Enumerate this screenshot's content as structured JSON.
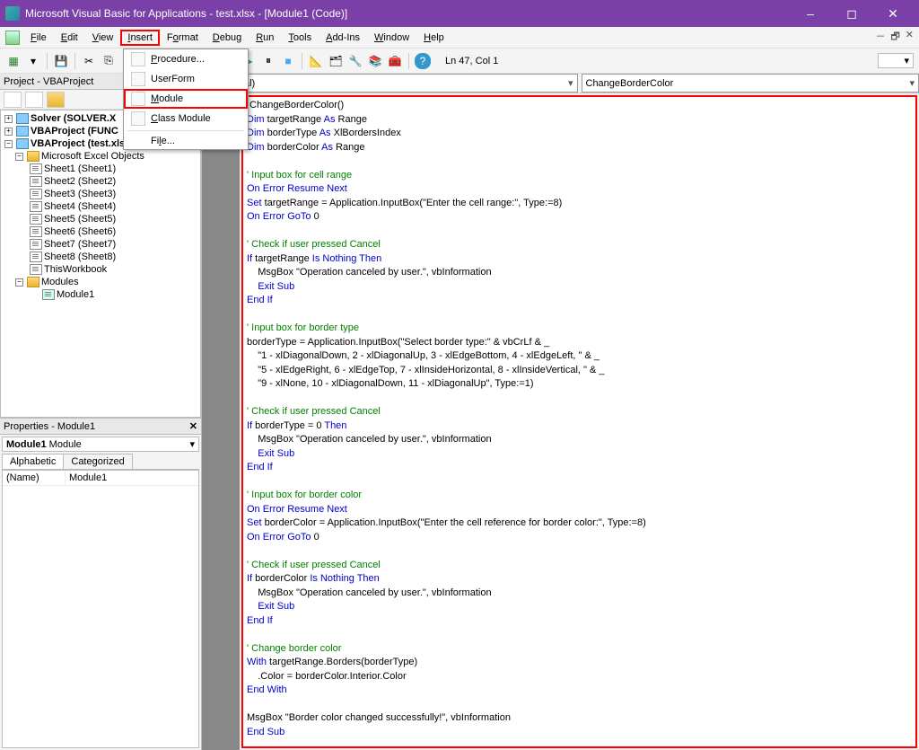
{
  "title": "Microsoft Visual Basic for Applications - test.xlsx - [Module1 (Code)]",
  "menus": {
    "file": "File",
    "edit": "Edit",
    "view": "View",
    "insert": "Insert",
    "format": "Format",
    "debug": "Debug",
    "run": "Run",
    "tools": "Tools",
    "addins": "Add-Ins",
    "window": "Window",
    "help": "Help"
  },
  "insert_menu": {
    "procedure": "Procedure...",
    "userform": "UserForm",
    "module": "Module",
    "classmodule": "Class Module",
    "file": "File..."
  },
  "status": "Ln 47, Col 1",
  "project_panel": {
    "title": "Project - VBAProject",
    "items": {
      "solver": "Solver (SOLVER.X",
      "func": "VBAProject (FUNC",
      "test": "VBAProject (test.xlsx)",
      "excelobj": "Microsoft Excel Objects",
      "sheet1": "Sheet1 (Sheet1)",
      "sheet2": "Sheet2 (Sheet2)",
      "sheet3": "Sheet3 (Sheet3)",
      "sheet4": "Sheet4 (Sheet4)",
      "sheet5": "Sheet5 (Sheet5)",
      "sheet6": "Sheet6 (Sheet6)",
      "sheet7": "Sheet7 (Sheet7)",
      "sheet8": "Sheet8 (Sheet8)",
      "thiswb": "ThisWorkbook",
      "modules": "Modules",
      "module1": "Module1"
    }
  },
  "props_panel": {
    "title": "Properties - Module1",
    "combo": "Module1 Module",
    "tabs": {
      "alpha": "Alphabetic",
      "cat": "Categorized"
    },
    "rows": {
      "name_key": "(Name)",
      "name_val": "Module1"
    }
  },
  "dropdowns": {
    "left": "al)",
    "right": "ChangeBorderColor"
  },
  "code": {
    "l1a": " ChangeBorderColor()",
    "l2a": "Dim",
    "l2b": " targetRange ",
    "l2c": "As",
    "l2d": " Range",
    "l3a": "Dim",
    "l3b": " borderType ",
    "l3c": "As",
    "l3d": " XlBordersIndex",
    "l4a": "Dim",
    "l4b": " borderColor ",
    "l4c": "As",
    "l4d": " Range",
    "c1": "' Input box for cell range",
    "l5a": "On Error Resume Next",
    "l6a": "Set",
    "l6b": " targetRange = Application.InputBox(\"Enter the cell range:\", Type:=8)",
    "l7a": "On Error GoTo",
    "l7b": " 0",
    "c2": "' Check if user pressed Cancel",
    "l8a": "If",
    "l8b": " targetRange ",
    "l8c": "Is Nothing Then",
    "l9": "    MsgBox \"Operation canceled by user.\", vbInformation",
    "l10a": "    ",
    "l10b": "Exit Sub",
    "l11": "End If",
    "c3": "' Input box for border type",
    "l12": "borderType = Application.InputBox(\"Select border type:\" & vbCrLf & _",
    "l13": "    \"1 - xlDiagonalDown, 2 - xlDiagonalUp, 3 - xlEdgeBottom, 4 - xlEdgeLeft, \" & _",
    "l14": "    \"5 - xlEdgeRight, 6 - xlEdgeTop, 7 - xlInsideHorizontal, 8 - xlInsideVertical, \" & _",
    "l15": "    \"9 - xlNone, 10 - xlDiagonalDown, 11 - xlDiagonalUp\", Type:=1)",
    "c4": "' Check if user pressed Cancel",
    "l16a": "If",
    "l16b": " borderType = 0 ",
    "l16c": "Then",
    "l17": "    MsgBox \"Operation canceled by user.\", vbInformation",
    "l18a": "    ",
    "l18b": "Exit Sub",
    "l19": "End If",
    "c5": "' Input box for border color",
    "l20": "On Error Resume Next",
    "l21a": "Set",
    "l21b": " borderColor = Application.InputBox(\"Enter the cell reference for border color:\", Type:=8)",
    "l22a": "On Error GoTo",
    "l22b": " 0",
    "c6": "' Check if user pressed Cancel",
    "l23a": "If",
    "l23b": " borderColor ",
    "l23c": "Is Nothing Then",
    "l24": "    MsgBox \"Operation canceled by user.\", vbInformation",
    "l25a": "    ",
    "l25b": "Exit Sub",
    "l26": "End If",
    "c7": "' Change border color",
    "l27a": "With",
    "l27b": " targetRange.Borders(borderType)",
    "l28": "    .Color = borderColor.Interior.Color",
    "l29": "End With",
    "l30": "MsgBox \"Border color changed successfully!\", vbInformation",
    "l31a": "End ",
    "l31b": "Sub"
  }
}
